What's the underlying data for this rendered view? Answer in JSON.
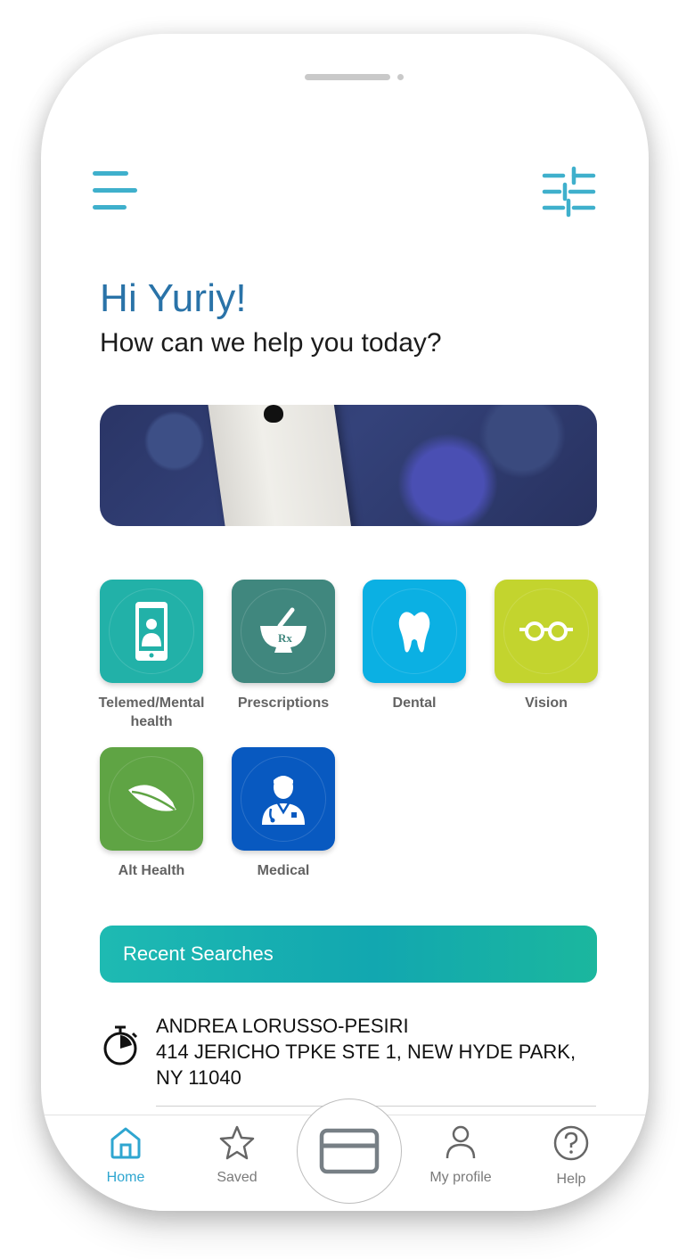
{
  "header": {
    "menu_icon": "hamburger-menu-icon",
    "filter_icon": "filter-sliders-icon"
  },
  "greeting": {
    "title": "Hi Yuriy!",
    "subtitle": "How can we help you today?"
  },
  "categories": [
    {
      "label": "Telemed/Mental health",
      "color": "#22b1a8",
      "icon": "phone-doctor-icon"
    },
    {
      "label": "Prescriptions",
      "color": "#40877e",
      "icon": "mortar-pestle-icon"
    },
    {
      "label": "Dental",
      "color": "#0bb0e3",
      "icon": "tooth-icon"
    },
    {
      "label": "Vision",
      "color": "#c3d42e",
      "icon": "glasses-icon"
    },
    {
      "label": "Alt Health",
      "color": "#5fa444",
      "icon": "leaf-icon"
    },
    {
      "label": "Medical",
      "color": "#0859c0",
      "icon": "doctor-icon"
    }
  ],
  "recent": {
    "title": "Recent Searches",
    "items": [
      {
        "name": "ANDREA LORUSSO-PESIRI",
        "address": "414 JERICHO TPKE STE 1, NEW HYDE PARK, NY 11040",
        "icon": "stopwatch-icon"
      }
    ]
  },
  "tabs": [
    {
      "label": "Home",
      "icon": "home-icon",
      "active": true
    },
    {
      "label": "Saved",
      "icon": "star-icon"
    },
    {
      "label": "My profile",
      "icon": "person-icon"
    },
    {
      "label": "Help",
      "icon": "help-icon"
    }
  ],
  "center_button": {
    "icon": "card-icon"
  },
  "colors": {
    "accent": "#2fa6d0",
    "greeting": "#2a73a8",
    "recent_bar": "#12a7b0"
  }
}
